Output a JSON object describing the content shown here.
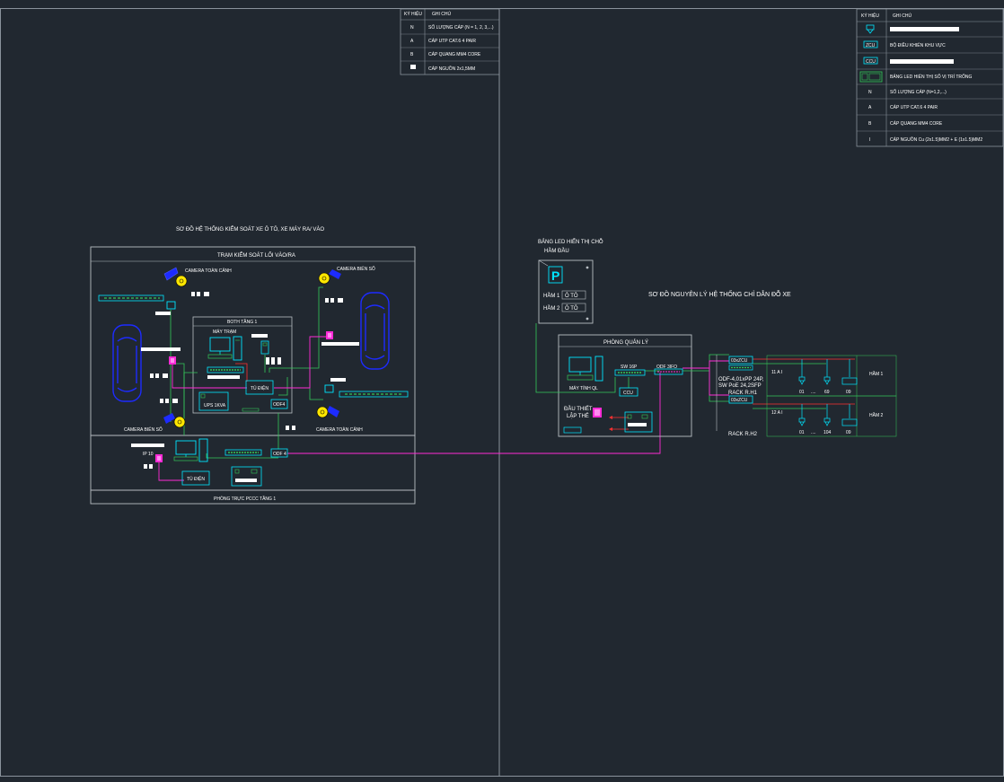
{
  "titles": {
    "left_diagram": "SƠ ĐỒ HỆ THỐNG KIỂM SOÁT XE Ô TÔ, XE MÁY RA/ VÀO",
    "right_diagram": "SƠ ĐỒ NGUYÊN LÝ HỆ THỐNG CHỈ DẪN ĐỖ XE"
  },
  "legend_left": {
    "header_symbol": "KÝ HIỆU",
    "header_note": "GHI CHÚ",
    "rows": [
      {
        "symbol": "N",
        "note": "SỐ LƯỢNG CÁP (N = 1, 2, 3,...)"
      },
      {
        "symbol": "A",
        "note": "CÁP UTP CAT.6 4 PAIR"
      },
      {
        "symbol": "B",
        "note": "CÁP QUANG MM4 CORE"
      },
      {
        "symbol": "",
        "note": "CÁP NGUỒN 2x1,5MM"
      }
    ]
  },
  "legend_right": {
    "header_symbol": "KÝ HIỆU",
    "header_note": "GHI CHÚ",
    "rows": [
      {
        "symbol": "sensor",
        "note": ""
      },
      {
        "symbol": "ZCU",
        "note": "BỘ ĐIỀU KHIỂN KHU VỰC"
      },
      {
        "symbol": "CCU",
        "note": ""
      },
      {
        "symbol": "led",
        "note": "BẢNG LED HIỂN THỊ SỐ VỊ TRÍ TRỐNG"
      },
      {
        "symbol": "N",
        "note": "SỐ LƯỢNG CÁP (N=1,2,...)"
      },
      {
        "symbol": "A",
        "note": "CÁP UTP CAT.6 4 PAIR"
      },
      {
        "symbol": "B",
        "note": "CÁP QUANG MM4 CORE"
      },
      {
        "symbol": "I",
        "note": "CÁP NGUỒN Cu (2x1.5)MM2 + E (1x1.5)MM2"
      }
    ]
  },
  "left": {
    "outer_title": "TRẠM KIỂM SOÁT LỐI VÀO/RA",
    "booth_title": "BOTH TẦNG 1",
    "workstation": "MÁY TRẠM",
    "panel": "TỦ ĐIỆN",
    "ups": "UPS 1KVA",
    "odf": "ODF4",
    "cam_overview_top": "CAMERA TOÀN CẢNH",
    "cam_plate_top": "CAMERA BIỂN SỐ",
    "cam_plate_bottom": "CAMERA BIỂN SỐ",
    "cam_overview_bottom": "CAMERA TOÀN CẢNH",
    "ip": "IP 10",
    "panel2": "TỦ ĐIỆN",
    "odf2": "ODF 4",
    "bottom_title": "PHÒNG TRỰC PCCC TẦNG 1"
  },
  "right": {
    "led_title_1": "BẢNG LED HIỂN THỊ CHỖ",
    "led_title_2": "HẦM ĐẦU",
    "ham1_label": "HẦM 1",
    "ham1_value": "Ô TÔ",
    "ham2_label": "HẦM 2",
    "ham2_value": "Ô TÔ",
    "room_title": "PHÒNG QUẢN LÝ",
    "sw": "SW 16P",
    "odf": "ODF 3IFO",
    "pc": "MÁY TÍNH QL",
    "ccu": "CCU",
    "reader_1": "ĐẦU THIẾT",
    "reader_2": "LẬP THẺ",
    "zcu1": "03xZCU",
    "zcu2": "03xZCU",
    "rack_desc_1": "ODF-4,01xPP 24P,",
    "rack_desc_2": "SW PoE 24,2SFP",
    "rack_h1": "RACK R.H1",
    "rack_h2": "RACK R.H2",
    "row1_label": "11  A  I",
    "row2_label": "12  A  I",
    "row1_sensors": [
      "01",
      "....",
      "69",
      "09"
    ],
    "row2_sensors": [
      "01",
      "....",
      "104",
      "09"
    ],
    "ham1": "HẦM 1",
    "ham2": "HẦM 2"
  },
  "colors": {
    "background": "#212830",
    "frame": "#9ba3ab",
    "cyan": "#00e5ff",
    "green": "#34c759",
    "magenta": "#ff2bd6",
    "blue": "#1d2bff",
    "red": "#ff3030",
    "yellow": "#ffe600"
  }
}
